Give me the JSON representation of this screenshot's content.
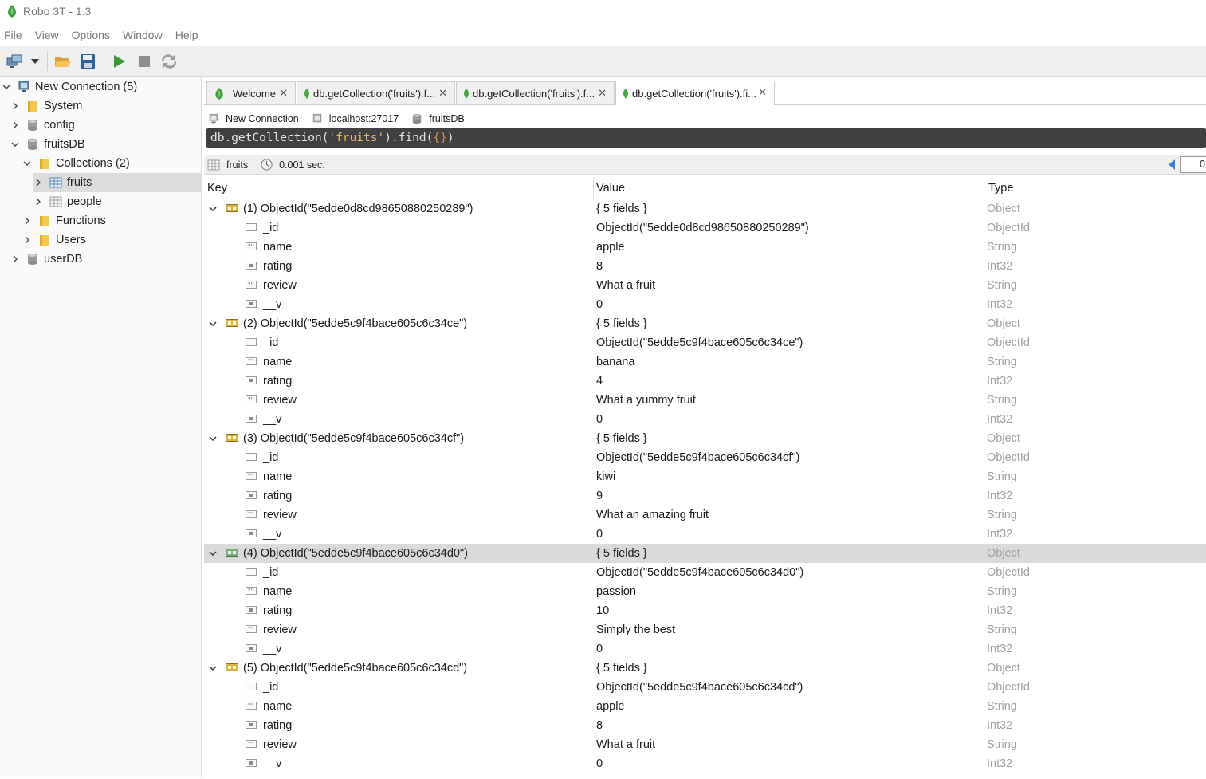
{
  "window": {
    "title": "Robo 3T - 1.3"
  },
  "menu": {
    "items": [
      "File",
      "View",
      "Options",
      "Window",
      "Help"
    ]
  },
  "sidebar": {
    "connection": "New Connection (5)",
    "system": "System",
    "config": "config",
    "fruitsdb": "fruitsDB",
    "collections": "Collections (2)",
    "fruits": "fruits",
    "people": "people",
    "functions": "Functions",
    "users": "Users",
    "userdb": "userDB"
  },
  "tabs": [
    {
      "label": "Welcome"
    },
    {
      "label": "db.getCollection('fruits').f..."
    },
    {
      "label": "db.getCollection('fruits').f..."
    },
    {
      "label": "db.getCollection('fruits').fi..."
    }
  ],
  "connection_info": {
    "connection": "New Connection",
    "host": "localhost:27017",
    "database": "fruitsDB"
  },
  "query": {
    "prefix": "db.getCollection(",
    "collection": "'fruits'",
    "middle": ").find(",
    "braces": "{}",
    "suffix": ")"
  },
  "results_bar": {
    "collection": "fruits",
    "time": "0.001 sec.",
    "page_value": "0"
  },
  "grid": {
    "headers": {
      "key": "Key",
      "value": "Value",
      "type": "Type"
    },
    "documents": [
      {
        "key": "(1) ObjectId(\"5edde0d8cd98650880250289\")",
        "value": "{ 5 fields }",
        "type": "Object",
        "fields": [
          {
            "key": "_id",
            "value": "ObjectId(\"5edde0d8cd98650880250289\")",
            "type": "ObjectId",
            "icon": "objectid-icon"
          },
          {
            "key": "name",
            "value": "apple",
            "type": "String",
            "icon": "string-icon"
          },
          {
            "key": "rating",
            "value": "8",
            "type": "Int32",
            "icon": "int-icon"
          },
          {
            "key": "review",
            "value": "What a fruit",
            "type": "String",
            "icon": "string-icon"
          },
          {
            "key": "__v",
            "value": "0",
            "type": "Int32",
            "icon": "int-icon"
          }
        ]
      },
      {
        "key": "(2) ObjectId(\"5edde5c9f4bace605c6c34ce\")",
        "value": "{ 5 fields }",
        "type": "Object",
        "fields": [
          {
            "key": "_id",
            "value": "ObjectId(\"5edde5c9f4bace605c6c34ce\")",
            "type": "ObjectId",
            "icon": "objectid-icon"
          },
          {
            "key": "name",
            "value": "banana",
            "type": "String",
            "icon": "string-icon"
          },
          {
            "key": "rating",
            "value": "4",
            "type": "Int32",
            "icon": "int-icon"
          },
          {
            "key": "review",
            "value": "What a yummy fruit",
            "type": "String",
            "icon": "string-icon"
          },
          {
            "key": "__v",
            "value": "0",
            "type": "Int32",
            "icon": "int-icon"
          }
        ]
      },
      {
        "key": "(3) ObjectId(\"5edde5c9f4bace605c6c34cf\")",
        "value": "{ 5 fields }",
        "type": "Object",
        "fields": [
          {
            "key": "_id",
            "value": "ObjectId(\"5edde5c9f4bace605c6c34cf\")",
            "type": "ObjectId",
            "icon": "objectid-icon"
          },
          {
            "key": "name",
            "value": "kiwi",
            "type": "String",
            "icon": "string-icon"
          },
          {
            "key": "rating",
            "value": "9",
            "type": "Int32",
            "icon": "int-icon"
          },
          {
            "key": "review",
            "value": "What an amazing fruit",
            "type": "String",
            "icon": "string-icon"
          },
          {
            "key": "__v",
            "value": "0",
            "type": "Int32",
            "icon": "int-icon"
          }
        ]
      },
      {
        "key": "(4) ObjectId(\"5edde5c9f4bace605c6c34d0\")",
        "value": "{ 5 fields }",
        "type": "Object",
        "highlighted": true,
        "fields": [
          {
            "key": "_id",
            "value": "ObjectId(\"5edde5c9f4bace605c6c34d0\")",
            "type": "ObjectId",
            "icon": "objectid-icon"
          },
          {
            "key": "name",
            "value": "passion",
            "type": "String",
            "icon": "string-icon"
          },
          {
            "key": "rating",
            "value": "10",
            "type": "Int32",
            "icon": "int-icon"
          },
          {
            "key": "review",
            "value": "Simply the best",
            "type": "String",
            "icon": "string-icon"
          },
          {
            "key": "__v",
            "value": "0",
            "type": "Int32",
            "icon": "int-icon"
          }
        ]
      },
      {
        "key": "(5) ObjectId(\"5edde5c9f4bace605c6c34cd\")",
        "value": "{ 5 fields }",
        "type": "Object",
        "fields": [
          {
            "key": "_id",
            "value": "ObjectId(\"5edde5c9f4bace605c6c34cd\")",
            "type": "ObjectId",
            "icon": "objectid-icon"
          },
          {
            "key": "name",
            "value": "apple",
            "type": "String",
            "icon": "string-icon"
          },
          {
            "key": "rating",
            "value": "8",
            "type": "Int32",
            "icon": "int-icon"
          },
          {
            "key": "review",
            "value": "What a fruit",
            "type": "String",
            "icon": "string-icon"
          },
          {
            "key": "__v",
            "value": "0",
            "type": "Int32",
            "icon": "int-icon"
          }
        ]
      }
    ]
  },
  "colors": {
    "type_text": "#a0a0a0",
    "selection": "#dadada",
    "query_bg": "#404040",
    "folder": "#f2c94c",
    "mongo_green": "#4aa54a"
  }
}
